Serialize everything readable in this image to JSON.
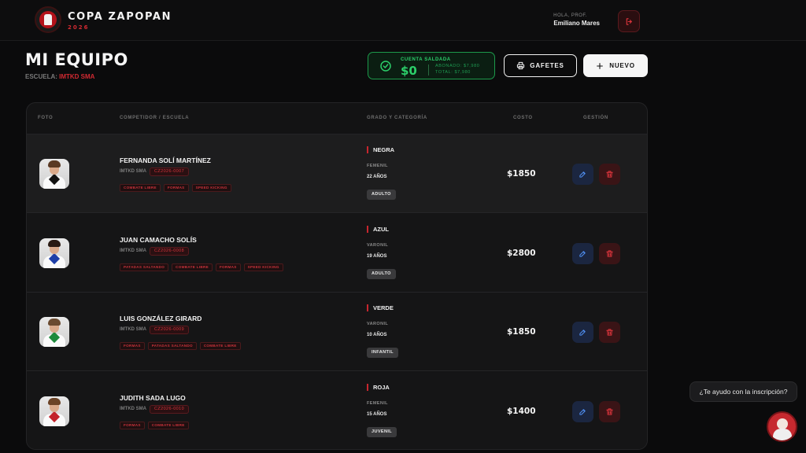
{
  "header": {
    "brand_title": "COPA ZAPOPAN",
    "brand_year": "2026",
    "greeting": "HOLA, PROF.",
    "user_name": "Emiliano Mares"
  },
  "page": {
    "title": "MI EQUIPO",
    "school_label": "ESCUELA:",
    "school_name": "IMTKD SMA"
  },
  "balance": {
    "label": "CUENTA SALDADA",
    "amount": "$0",
    "paid": "ABONADO: $7,980",
    "total": "TOTAL: $7,980"
  },
  "toolbar": {
    "gafetes_label": "GAFETES",
    "nuevo_label": "NUEVO"
  },
  "table": {
    "headers": {
      "photo": "FOTO",
      "competitor": "COMPETIDOR / ESCUELA",
      "grade": "GRADO Y CATEGORÍA",
      "cost": "COSTO",
      "manage": "GESTIÓN"
    },
    "rows": [
      {
        "name": "FERNANDA SOLÍ MARTÍNEZ",
        "school": "IMTKD SMA",
        "code": "CZ2026-0007",
        "tags": [
          "COMBATE LIBRE",
          "FORMAS",
          "SPEED KICKING"
        ],
        "belt": "NEGRA",
        "gender": "FEMENIL",
        "age": "22 AÑOS",
        "category": "ADULTO",
        "cost": "$1850",
        "hair_color": "#5a3a24",
        "collar_color": "#111111"
      },
      {
        "name": "JUAN CAMACHO SOLÍS",
        "school": "IMTKD SMA",
        "code": "CZ2026-0008",
        "tags": [
          "PATADAS SALTANDO",
          "COMBATE LIBRE",
          "FORMAS",
          "SPEED KICKING"
        ],
        "belt": "AZUL",
        "gender": "VARONIL",
        "age": "19 AÑOS",
        "category": "ADULTO",
        "cost": "$2800",
        "hair_color": "#2a1a12",
        "collar_color": "#1f3fa8"
      },
      {
        "name": "LUIS GONZÁLEZ GIRARD",
        "school": "IMTKD SMA",
        "code": "CZ2026-0009",
        "tags": [
          "FORMAS",
          "PATADAS SALTANDO",
          "COMBATE LIBRE"
        ],
        "belt": "VERDE",
        "gender": "VARONIL",
        "age": "10 AÑOS",
        "category": "INFANTIL",
        "cost": "$1850",
        "hair_color": "#6a4a30",
        "collar_color": "#1e8a3c"
      },
      {
        "name": "JUDITH SADA LUGO",
        "school": "IMTKD SMA",
        "code": "CZ2026-0010",
        "tags": [
          "FORMAS",
          "COMBATE LIBRE"
        ],
        "belt": "ROJA",
        "gender": "FEMENIL",
        "age": "15 AÑOS",
        "category": "JUVENIL",
        "cost": "$1400",
        "hair_color": "#6b4326",
        "collar_color": "#c3232b"
      }
    ]
  },
  "help": {
    "text": "¿Te ayudo con la inscripción?"
  },
  "colors": {
    "accent_red": "#d22a32",
    "success_green": "#2ccf6a",
    "background": "#0b0b0c"
  }
}
